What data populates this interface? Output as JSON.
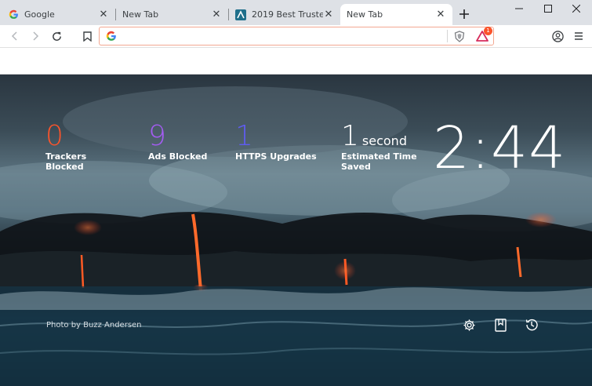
{
  "tabs": [
    {
      "title": "Google",
      "favicon": "google-g-icon",
      "active": false
    },
    {
      "title": "New Tab",
      "favicon": "none",
      "active": false
    },
    {
      "title": "2019 Best Trusted VPN",
      "favicon": "vpn-site-icon",
      "active": false
    },
    {
      "title": "New Tab",
      "favicon": "none",
      "active": true
    }
  ],
  "omnibox": {
    "value": "",
    "placeholder": "",
    "shield_badge": "brave-shield-icon",
    "rewards_badge": "1"
  },
  "stats": {
    "trackers": {
      "value": "0",
      "label_line1": "Trackers",
      "label_line2": "Blocked",
      "color": "#fb542b"
    },
    "ads": {
      "value": "9",
      "label_line1": "Ads Blocked",
      "color": "#a45cf2"
    },
    "https": {
      "value": "1",
      "label_line1": "HTTPS Upgrades",
      "color": "#5f5cf1"
    },
    "time": {
      "value": "1",
      "unit": "second",
      "label_line1": "Estimated Time",
      "label_line2": "Saved",
      "color": "#ffffff"
    }
  },
  "clock": "2:44",
  "photo_credit": "Photo by Buzz Andersen",
  "colors": {
    "accent": "#fb542b",
    "tabstrip": "#dee1e6",
    "omnibox_border": "#f3a892"
  }
}
